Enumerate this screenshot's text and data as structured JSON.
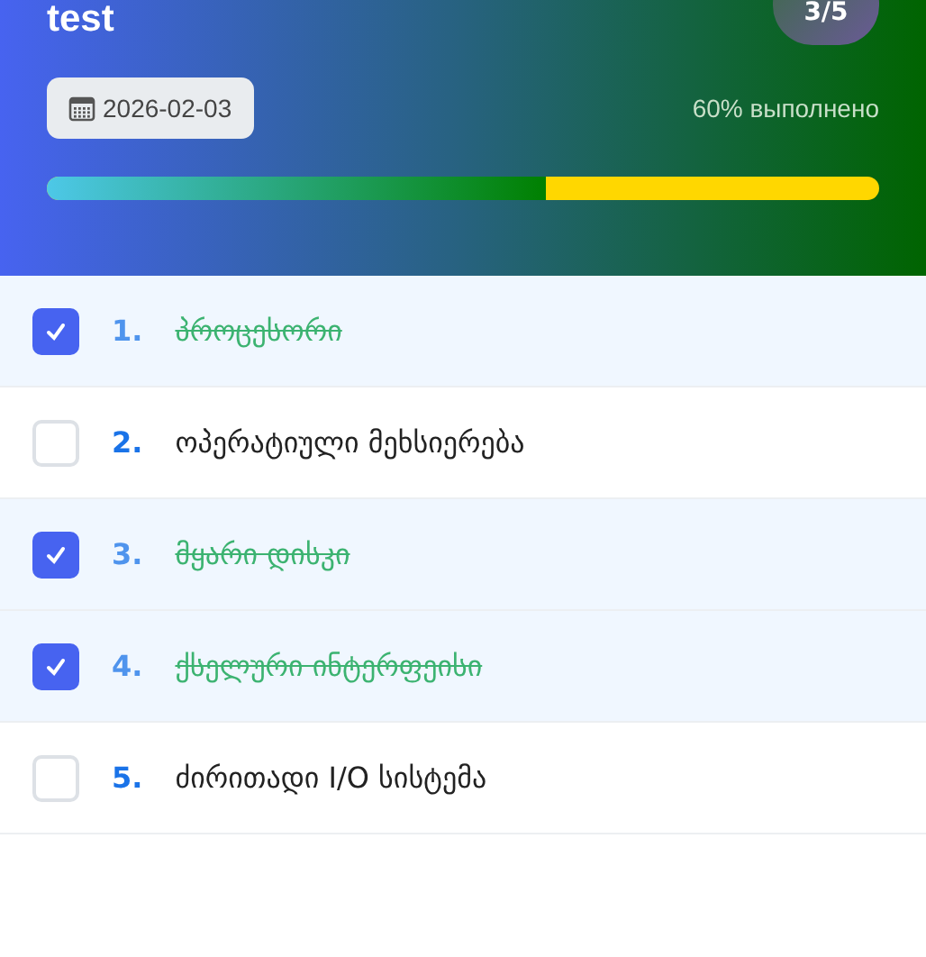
{
  "header": {
    "title": "test",
    "badge": "3/5",
    "date": "2026-02-03",
    "progress_text": "60% выполнено",
    "level": 0.6
  },
  "tasks": [
    {
      "number": "1.",
      "label": "პროცესორი",
      "checked": true
    },
    {
      "number": "2.",
      "label": "ოპერატიული მეხსიერება",
      "checked": false
    },
    {
      "number": "3.",
      "label": "მყარი დისკი",
      "checked": true
    },
    {
      "number": "4.",
      "label": "ქსელური ინტერფეისი",
      "checked": true
    },
    {
      "number": "5.",
      "label": "ძირითადი I/O სისტემა",
      "checked": false
    }
  ]
}
